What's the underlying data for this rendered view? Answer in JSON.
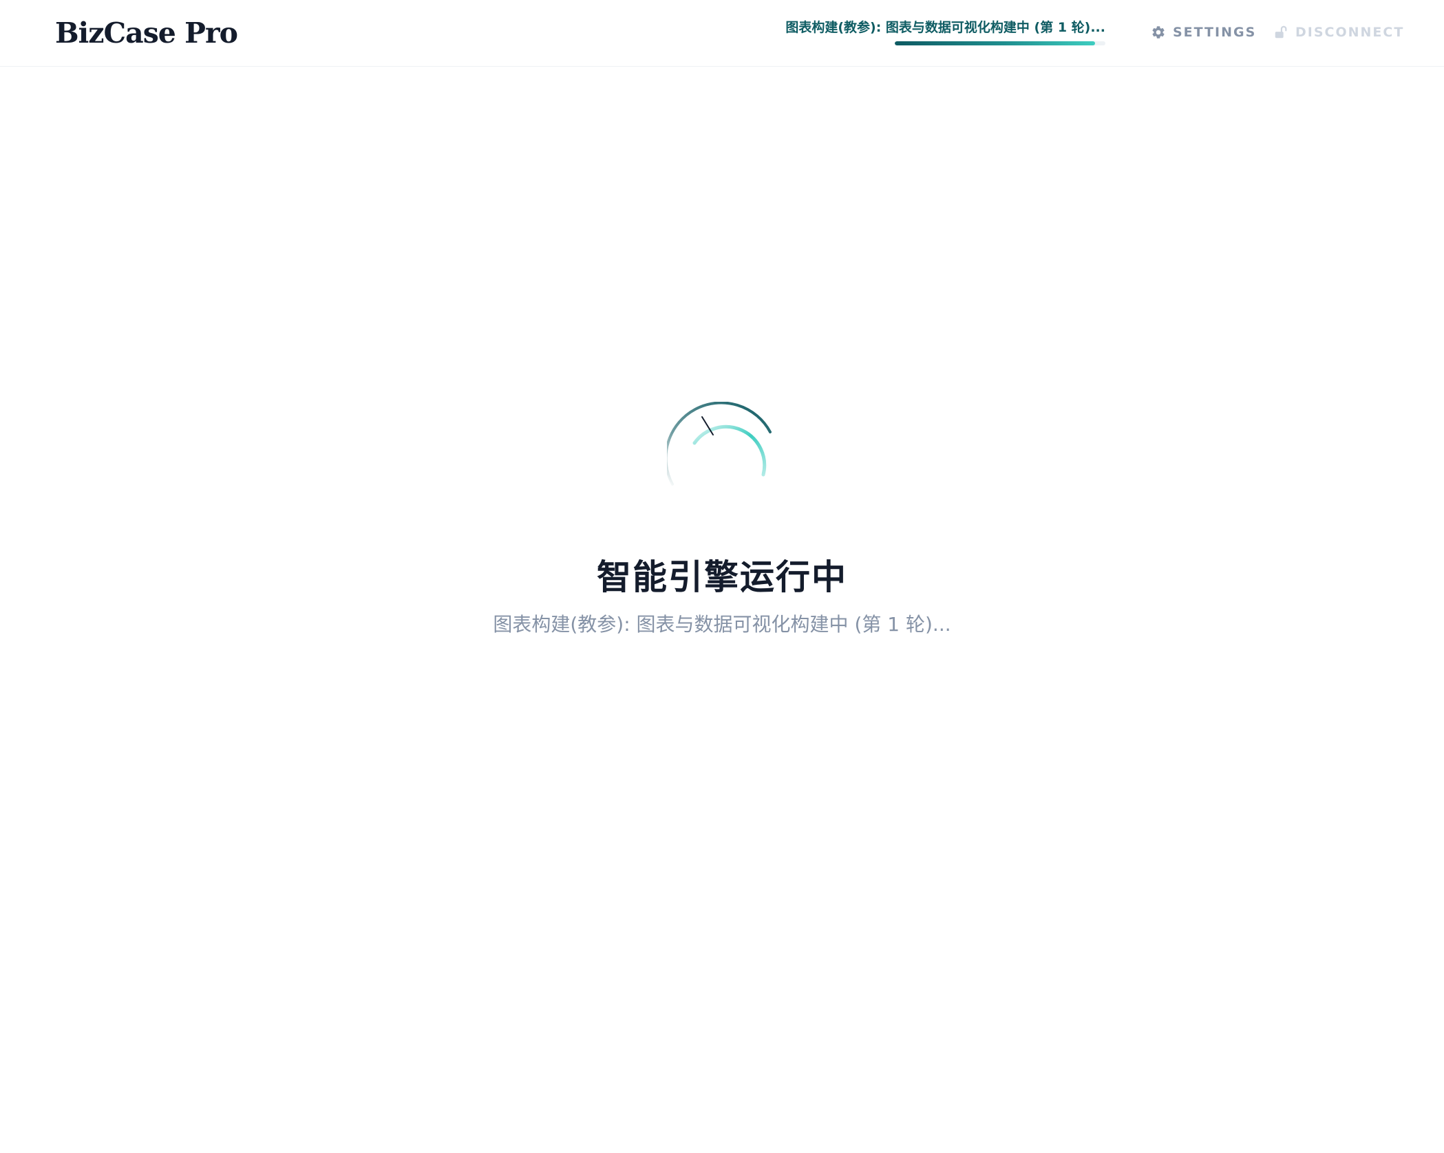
{
  "app": {
    "brand": "BizCase Pro"
  },
  "header": {
    "progress_text": "图表构建(教参): 图表与数据可视化构建中 (第 1 轮)...",
    "progress_fraction": 0.95,
    "settings_label": "SETTINGS",
    "settings_icon": "gear-icon",
    "disconnect_label": "DISCONNECT",
    "disconnect_icon": "unlock-icon"
  },
  "main": {
    "title": "智能引擎运行中",
    "status": "图表构建(教参): 图表与数据可视化构建中 (第 1 轮)..."
  },
  "colors": {
    "brand_text": "#141c2c",
    "accent_dark": "#0f5c63",
    "accent_light": "#3ecdc0",
    "muted": "#8592a6",
    "disabled": "#cfd6e0"
  }
}
